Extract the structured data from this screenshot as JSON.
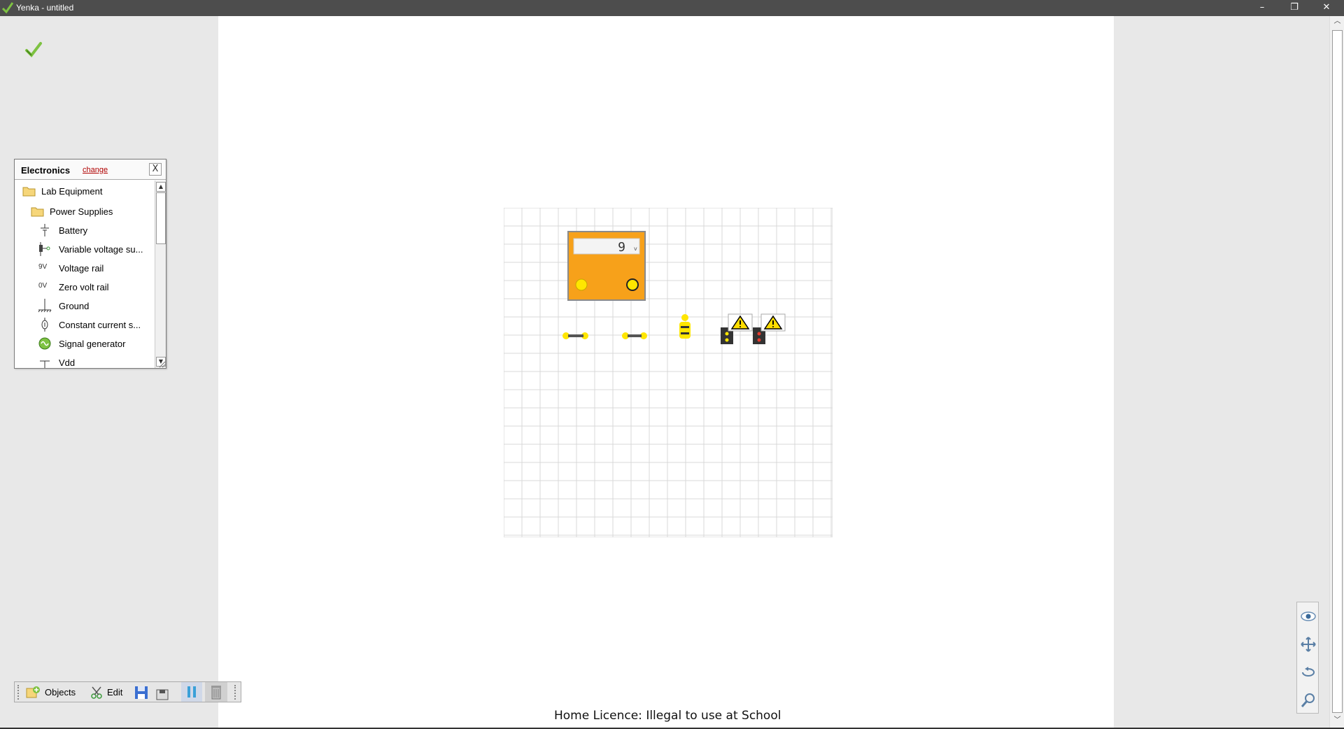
{
  "window": {
    "title": "Yenka - untitled",
    "minimize": "–",
    "restore": "❐",
    "close": "✕"
  },
  "library": {
    "title": "Electronics",
    "change_link": "change",
    "close": "X",
    "items": [
      {
        "label": "Lab Equipment",
        "icon": "folder-open-icon"
      },
      {
        "label": "Power Supplies",
        "icon": "folder-open-icon"
      },
      {
        "label": "Battery",
        "icon": "battery-symbol-icon"
      },
      {
        "label": "Variable voltage su...",
        "icon": "variable-supply-symbol-icon"
      },
      {
        "label": "Voltage rail",
        "icon": "voltage-rail-icon",
        "icon_text": "9V"
      },
      {
        "label": "Zero volt rail",
        "icon": "zero-volt-rail-icon",
        "icon_text": "0V"
      },
      {
        "label": "Ground",
        "icon": "ground-symbol-icon"
      },
      {
        "label": "Constant current s...",
        "icon": "current-source-symbol-icon"
      },
      {
        "label": "Signal generator",
        "icon": "signal-generator-icon"
      },
      {
        "label": "Vdd",
        "icon": "vdd-symbol-icon"
      }
    ]
  },
  "toolbar": {
    "objects_label": "Objects",
    "edit_label": "Edit"
  },
  "board": {
    "power_supply_display": "9",
    "power_supply_unit": "v"
  },
  "licence_text": "Home Licence: Illegal to use at School",
  "colors": {
    "titlebar": "#4d4d4d",
    "panel_bg": "#e8e8e8",
    "power_supply_orange": "#f7a11a",
    "terminal_yellow": "#ffe600",
    "warning_yellow": "#ffdd00",
    "link_red": "#b00000"
  }
}
